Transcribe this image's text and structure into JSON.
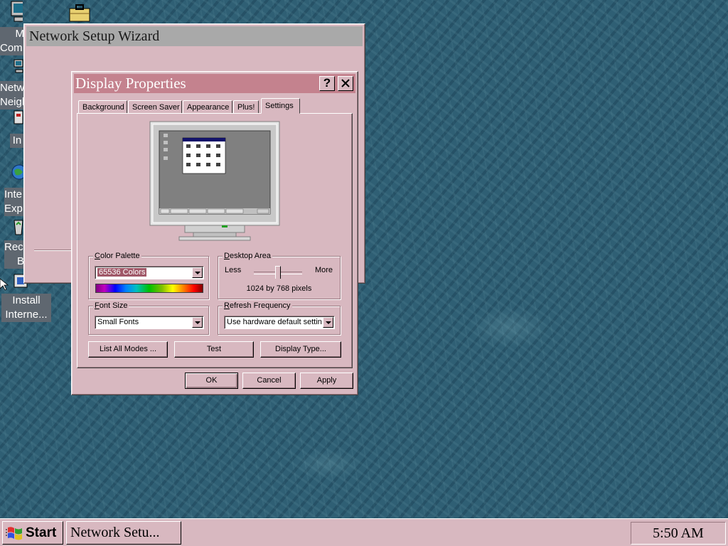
{
  "desktop": {
    "icons": [
      {
        "label": "My Computer",
        "visible": "M\nCom",
        "icon": "computer-icon"
      },
      {
        "label": "Network Neighborhood",
        "visible": "Netw\nNeigh",
        "icon": "network-icon"
      },
      {
        "label": "Inbox",
        "visible": "In",
        "icon": "inbox-icon"
      },
      {
        "label": "Internet Explorer",
        "visible": "Inte\nExp",
        "icon": "globe-icon"
      },
      {
        "label": "Recycle Bin",
        "visible": "Rec\nB",
        "icon": "recycle-bin-icon"
      },
      {
        "label": "Install Interne...",
        "line1": "Install",
        "line2": "Interne...",
        "icon": "install-icon"
      }
    ],
    "briefcase_icon": "briefcase-icon"
  },
  "wizard": {
    "title": "Network Setup Wizard"
  },
  "dialog": {
    "title": "Display Properties",
    "help_label": "?",
    "close_label": "✕",
    "tabs": [
      "Background",
      "Screen Saver",
      "Appearance",
      "Plus!",
      "Settings"
    ],
    "active_tab": "Settings",
    "color_palette": {
      "label": "Color Palette",
      "value": "65536 Colors"
    },
    "desktop_area": {
      "label": "Desktop Area",
      "less": "Less",
      "more": "More",
      "value": "1024 by 768 pixels",
      "slider_position": 0.5
    },
    "font_size": {
      "label": "Font Size",
      "value": "Small Fonts"
    },
    "refresh_frequency": {
      "label": "Refresh Frequency",
      "value": "Use hardware default setting"
    },
    "buttons": {
      "list_all_modes": "List All Modes ...",
      "test": "Test",
      "display_type": "Display Type..."
    },
    "footer": {
      "ok": "OK",
      "cancel": "Cancel",
      "apply": "Apply"
    }
  },
  "taskbar": {
    "start_label": "Start",
    "task_label": "Network Setu...",
    "clock": "5:50 AM"
  },
  "colors": {
    "face": "#d8b8c0",
    "title_active": "#c4828e",
    "title_inactive": "#a9a9a9",
    "selection": "#a05868",
    "desktop": "#2f5f74"
  }
}
